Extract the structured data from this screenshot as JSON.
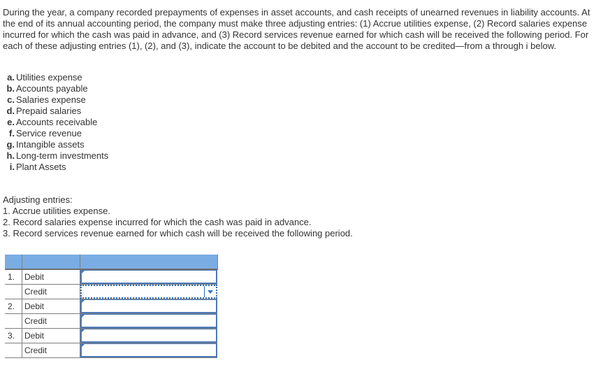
{
  "question": {
    "intro": "During the year, a company recorded prepayments of expenses in asset accounts, and cash receipts of unearned revenues in liability accounts. At the end of its annual accounting period, the company must make three adjusting entries: (1) Accrue utilities expense, (2) Record salaries expense incurred for which the cash was paid in advance, and (3) Record services revenue earned for which cash will be received the following period. For each of these adjusting entries (1), (2), and (3), indicate the account to be debited and the account to be credited—from a through i below."
  },
  "accounts": [
    {
      "letter": "a.",
      "name": "Utilities expense"
    },
    {
      "letter": "b.",
      "name": "Accounts payable"
    },
    {
      "letter": "c.",
      "name": "Salaries expense"
    },
    {
      "letter": "d.",
      "name": "Prepaid salaries"
    },
    {
      "letter": "e.",
      "name": "Accounts receivable"
    },
    {
      "letter": "f.",
      "name": "Service revenue"
    },
    {
      "letter": "g.",
      "name": "Intangible assets"
    },
    {
      "letter": "h.",
      "name": "Long-term investments"
    },
    {
      "letter": "i.",
      "name": "Plant Assets"
    }
  ],
  "adjusting": {
    "heading": "Adjusting entries:",
    "items": [
      "1. Accrue utilities expense.",
      "2. Record salaries expense incurred for which the cash was paid in advance.",
      "3. Record services revenue earned for which cash will be received the following period."
    ]
  },
  "table": {
    "header": [
      "",
      "",
      ""
    ],
    "rows": [
      {
        "num": "1.",
        "side": "Debit",
        "value": ""
      },
      {
        "num": "",
        "side": "Credit",
        "value": ""
      },
      {
        "num": "2.",
        "side": "Debit",
        "value": ""
      },
      {
        "num": "",
        "side": "Credit",
        "value": ""
      },
      {
        "num": "3.",
        "side": "Debit",
        "value": ""
      },
      {
        "num": "",
        "side": "Credit",
        "value": ""
      }
    ]
  },
  "colors": {
    "header_bg": "#7aade3",
    "field_border": "#4d7ab8",
    "text": "#333333"
  }
}
